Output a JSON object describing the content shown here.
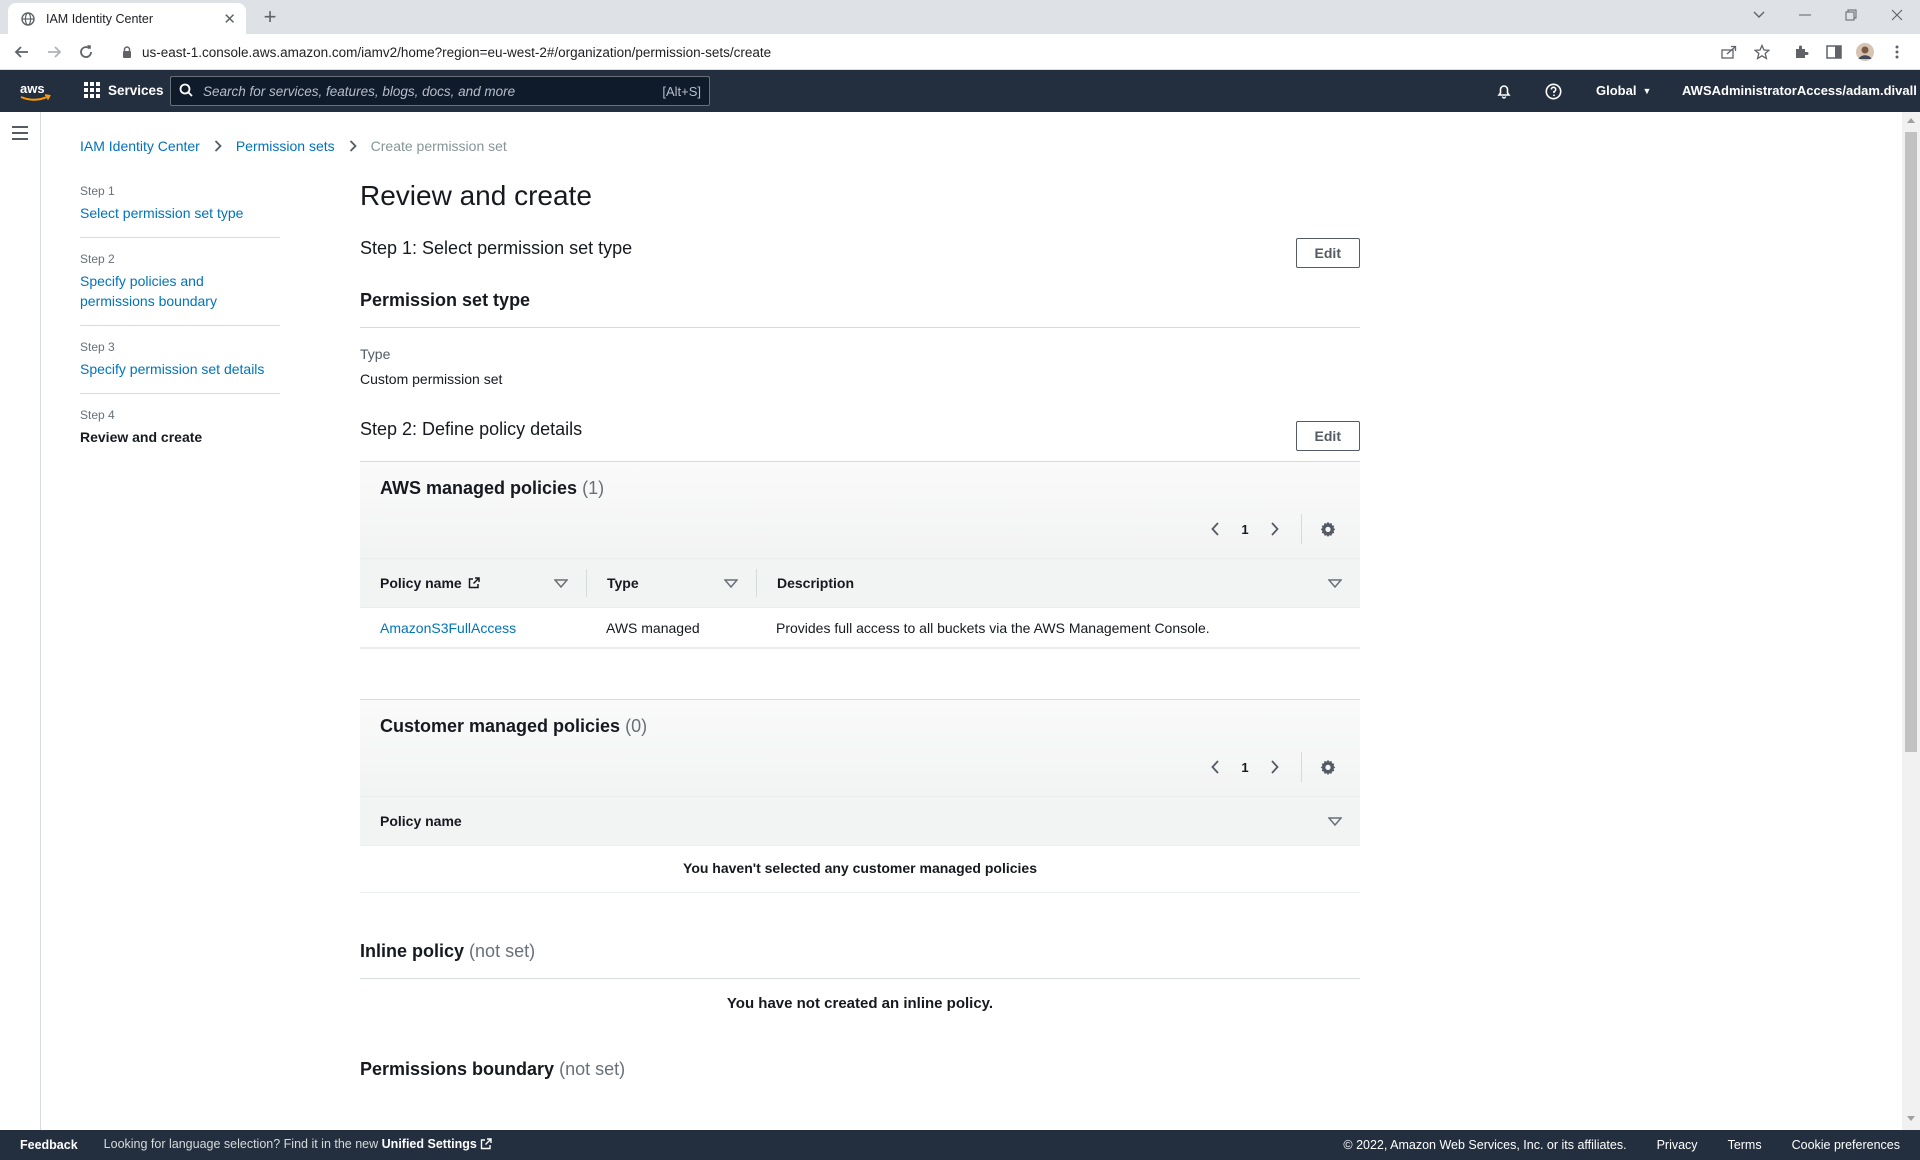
{
  "browser": {
    "tab_title": "IAM Identity Center",
    "url": "us-east-1.console.aws.amazon.com/iamv2/home?region=eu-west-2#/organization/permission-sets/create"
  },
  "topnav": {
    "services_label": "Services",
    "search_placeholder": "Search for services, features, blogs, docs, and more",
    "search_shortcut": "[Alt+S]",
    "region_label": "Global",
    "account_label": "AWSAdministratorAccess/adam.divall"
  },
  "breadcrumb": {
    "items": [
      "IAM Identity Center",
      "Permission sets"
    ],
    "current": "Create permission set"
  },
  "steps": [
    {
      "num": "Step 1",
      "label": "Select permission set type"
    },
    {
      "num": "Step 2",
      "label": "Specify policies and permissions boundary"
    },
    {
      "num": "Step 3",
      "label": "Specify permission set details"
    },
    {
      "num": "Step 4",
      "label": "Review and create"
    }
  ],
  "main": {
    "title": "Review and create",
    "step1": {
      "title": "Step 1: Select permission set type",
      "edit_label": "Edit",
      "section_title": "Permission set type",
      "type_key": "Type",
      "type_value": "Custom permission set"
    },
    "step2": {
      "title": "Step 2: Define policy details",
      "edit_label": "Edit",
      "aws_managed": {
        "title": "AWS managed policies",
        "count": "(1)",
        "page": "1",
        "columns": [
          "Policy name",
          "Type",
          "Description"
        ],
        "rows": [
          {
            "name": "AmazonS3FullAccess",
            "type": "AWS managed",
            "description": "Provides full access to all buckets via the AWS Management Console."
          }
        ]
      },
      "customer_managed": {
        "title": "Customer managed policies",
        "count": "(0)",
        "page": "1",
        "columns": [
          "Policy name"
        ],
        "empty": "You haven't selected any customer managed policies"
      },
      "inline": {
        "title": "Inline policy",
        "status": "(not set)",
        "empty": "You have not created an inline policy."
      },
      "boundary": {
        "title": "Permissions boundary",
        "status": "(not set)"
      }
    }
  },
  "footer": {
    "feedback": "Feedback",
    "lang_text": "Looking for language selection? Find it in the new",
    "lang_link": "Unified Settings",
    "copyright": "© 2022, Amazon Web Services, Inc. or its affiliates.",
    "privacy": "Privacy",
    "terms": "Terms",
    "cookies": "Cookie preferences"
  },
  "colors": {
    "aws_nav": "#232f3e",
    "link": "#0073bb",
    "aws_orange": "#ff9900"
  }
}
